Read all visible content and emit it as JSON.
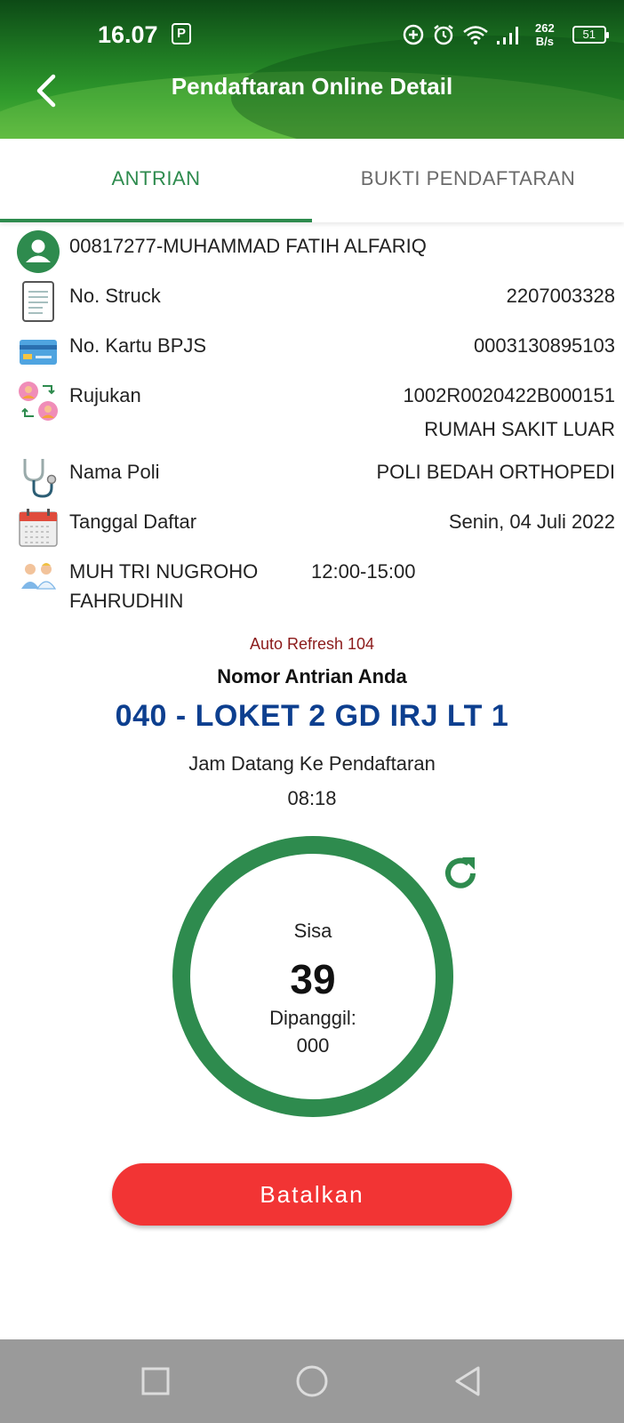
{
  "status_bar": {
    "time": "16.07",
    "speed_value": "262",
    "speed_unit": "B/s",
    "battery": "51",
    "icons": [
      "parking-icon",
      "data-saver-icon",
      "alarm-icon",
      "wifi-icon",
      "signal-icon",
      "battery-icon"
    ]
  },
  "header": {
    "title": "Pendaftaran Online Detail",
    "back_icon": "chevron-left-icon"
  },
  "tabs": [
    {
      "label": "ANTRIAN",
      "active": true
    },
    {
      "label": "BUKTI PENDAFTARAN",
      "active": false
    }
  ],
  "colors": {
    "accent_green": "#2e8b4e",
    "queue_blue": "#0d3f8f",
    "cancel_red": "#f23434",
    "refresh_red": "#8b1a1a"
  },
  "details": {
    "patient": "00817277-MUHAMMAD FATIH ALFARIQ",
    "struck_label": "No. Struck",
    "struck_value": "2207003328",
    "bpjs_label": "No. Kartu BPJS",
    "bpjs_value": "0003130895103",
    "rujukan_label": "Rujukan",
    "rujukan_value": "1002R0020422B000151",
    "rujukan_source": "RUMAH SAKIT LUAR",
    "poli_label": "Nama Poli",
    "poli_value": "POLI BEDAH ORTHOPEDI",
    "tanggal_label": "Tanggal Daftar",
    "tanggal_value": "Senin, 04 Juli 2022",
    "doctor_line1": "MUH TRI NUGROHO",
    "doctor_line2": "FAHRUDHIN",
    "doctor_schedule": "12:00-15:00"
  },
  "queue": {
    "auto_refresh": "Auto Refresh 104",
    "label": "Nomor Antrian Anda",
    "number": "040 - LOKET 2 GD IRJ LT 1",
    "arrival_label": "Jam Datang Ke Pendaftaran",
    "arrival_time": "08:18",
    "remaining_label": "Sisa",
    "remaining_count": "39",
    "called_label": "Dipanggil:",
    "called_value": "000"
  },
  "actions": {
    "cancel_label": "Batalkan"
  },
  "navbar": {
    "buttons": [
      "recents-square-icon",
      "home-circle-icon",
      "back-triangle-icon"
    ]
  }
}
